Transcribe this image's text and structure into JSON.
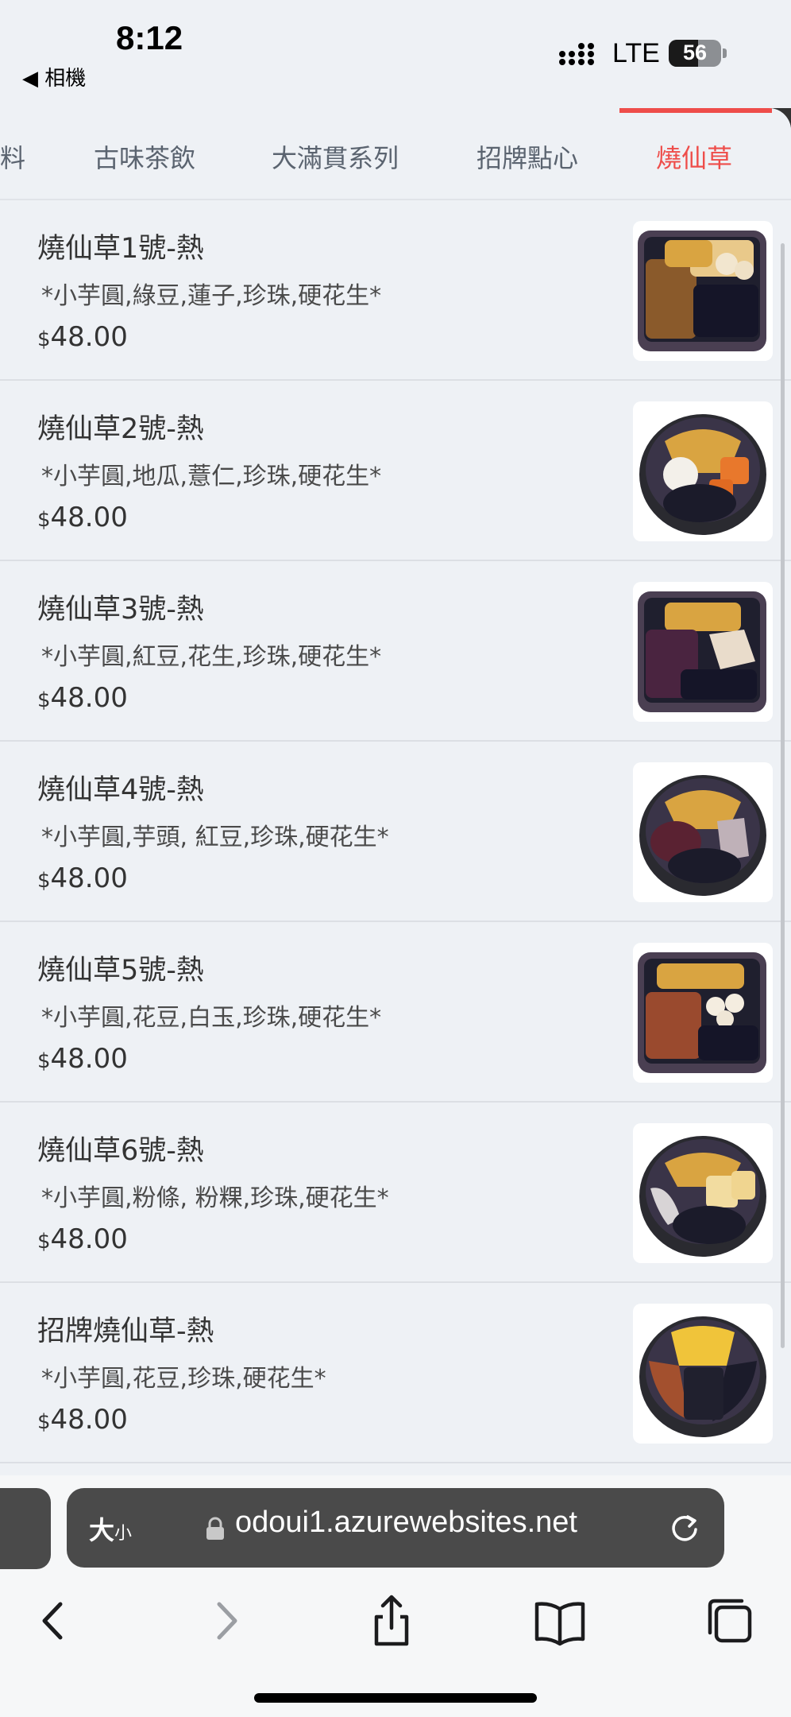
{
  "status_bar": {
    "time": "8:12",
    "back_app": "◀ 相機",
    "network": "LTE",
    "battery": "56",
    "battery_level": 0.56
  },
  "tabs": [
    {
      "label": "料",
      "active": false
    },
    {
      "label": "古味茶飲",
      "active": false
    },
    {
      "label": "大滿貫系列",
      "active": false
    },
    {
      "label": "招牌點心",
      "active": false
    },
    {
      "label": "燒仙草",
      "active": true
    }
  ],
  "currency_symbol": "$",
  "items": [
    {
      "name": "燒仙草1號-熱",
      "desc": "*小芋圓,綠豆,蓮子,珍珠,硬花生*",
      "price": "48.00"
    },
    {
      "name": "燒仙草2號-熱",
      "desc": "*小芋圓,地瓜,薏仁,珍珠,硬花生*",
      "price": "48.00"
    },
    {
      "name": "燒仙草3號-熱",
      "desc": "*小芋圓,紅豆,花生,珍珠,硬花生*",
      "price": "48.00"
    },
    {
      "name": "燒仙草4號-熱",
      "desc": "*小芋圓,芋頭, 紅豆,珍珠,硬花生*",
      "price": "48.00"
    },
    {
      "name": "燒仙草5號-熱",
      "desc": "*小芋圓,花豆,白玉,珍珠,硬花生*",
      "price": "48.00"
    },
    {
      "name": "燒仙草6號-熱",
      "desc": "*小芋圓,粉條, 粉粿,珍珠,硬花生*",
      "price": "48.00"
    },
    {
      "name": "招牌燒仙草-熱",
      "desc": "*小芋圓,花豆,珍珠,硬花生*",
      "price": "48.00"
    }
  ],
  "browser": {
    "text_size_label": "大",
    "text_size_small": "小",
    "url": "odoui1.azurewebsites.net"
  },
  "colors": {
    "accent": "#ee4d4a",
    "background": "#eef1f5",
    "url_bar": "#4a4a4a"
  },
  "icons": [
    "back-icon",
    "forward-icon",
    "share-icon",
    "bookmarks-icon",
    "tabs-icon",
    "lock-icon",
    "reload-icon"
  ]
}
